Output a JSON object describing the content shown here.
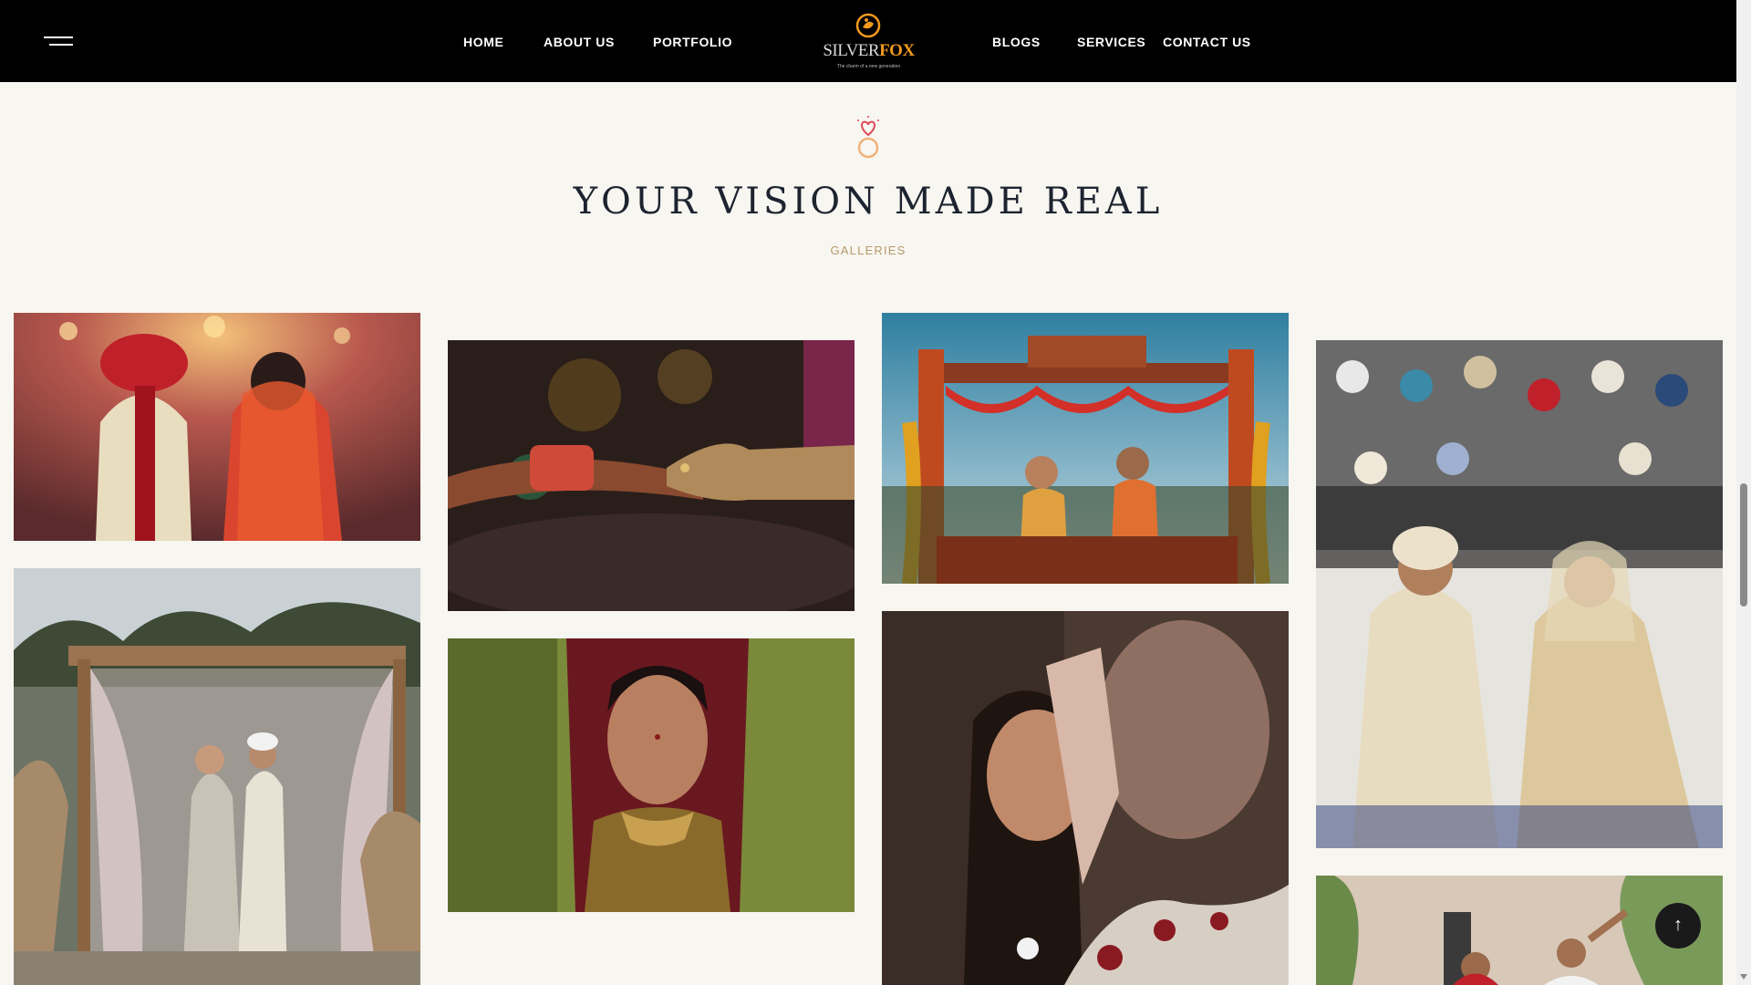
{
  "header": {
    "nav_left": [
      "HOME",
      "ABOUT US",
      "PORTFOLIO"
    ],
    "nav_right": [
      "BLOGS",
      "SERVICES",
      "CONTACT US"
    ],
    "logo": {
      "part1": "SILVER",
      "part2": "FOX",
      "tagline": "The charm of a new generation"
    }
  },
  "section": {
    "title": "YOUR VISION MADE REAL",
    "subtitle": "GALLERIES"
  },
  "gallery": {
    "tiles": [
      "couple-back-view-photo",
      "ring-exchange-photo",
      "floral-swing-photo",
      "sikh-ceremony-photo",
      "pergola-couple-photo",
      "bride-portrait-photo",
      "smiling-bride-photo",
      "celebration-photo"
    ]
  },
  "colors": {
    "header_bg": "#000000",
    "page_bg": "#f8f6f1",
    "title": "#1d2430",
    "accent_gold": "#b59a6a",
    "logo_orange": "#f39a1d"
  },
  "back_to_top": {
    "icon": "arrow-up-icon",
    "glyph": "↑"
  }
}
